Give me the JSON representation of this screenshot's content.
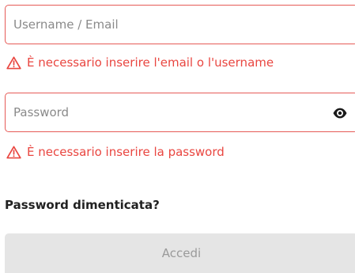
{
  "username": {
    "placeholder": "Username / Email",
    "value": "",
    "error": "È necessario inserire l'email o l'username"
  },
  "password": {
    "placeholder": "Password",
    "value": "",
    "error": "È necessario inserire la password",
    "toggle_icon": "eye-icon"
  },
  "forgot_password_label": "Password dimenticata?",
  "submit_label": "Accedi",
  "colors": {
    "error": "#e94640",
    "field_border_error": "#e65b57",
    "button_disabled_bg": "#e5e5e5",
    "button_disabled_text": "#9a9a9a"
  },
  "icons": {
    "error_icon": "warning-triangle-icon",
    "password_toggle": "eye-icon"
  }
}
